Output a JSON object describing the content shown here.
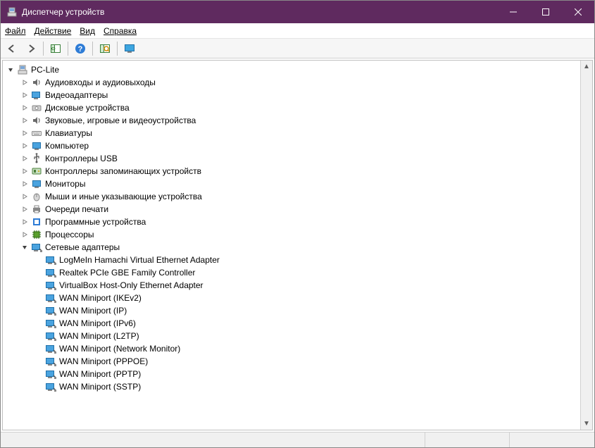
{
  "window": {
    "title": "Диспетчер устройств"
  },
  "menu": {
    "file": "Файл",
    "action": "Действие",
    "view": "Вид",
    "help": "Справка"
  },
  "toolbar": {
    "back": "Назад",
    "forward": "Вперёд",
    "show_hide": "Показать/скрыть дерево консоли",
    "help": "Справка",
    "scan": "Обновить конфигурацию оборудования",
    "monitor": "Мониторинг"
  },
  "tree": {
    "root": {
      "label": "PC-Lite",
      "icon": "computer-icon",
      "expanded": true
    },
    "categories": [
      {
        "label": "Аудиовходы и аудиовыходы",
        "icon": "audio-icon",
        "expanded": false,
        "children": []
      },
      {
        "label": "Видеоадаптеры",
        "icon": "display-adapter-icon",
        "expanded": false,
        "children": []
      },
      {
        "label": "Дисковые устройства",
        "icon": "disk-icon",
        "expanded": false,
        "children": []
      },
      {
        "label": "Звуковые, игровые и видеоустройства",
        "icon": "sound-icon",
        "expanded": false,
        "children": []
      },
      {
        "label": "Клавиатуры",
        "icon": "keyboard-icon",
        "expanded": false,
        "children": []
      },
      {
        "label": "Компьютер",
        "icon": "pc-icon",
        "expanded": false,
        "children": []
      },
      {
        "label": "Контроллеры USB",
        "icon": "usb-icon",
        "expanded": false,
        "children": []
      },
      {
        "label": "Контроллеры запоминающих устройств",
        "icon": "storage-ctrl-icon",
        "expanded": false,
        "children": []
      },
      {
        "label": "Мониторы",
        "icon": "monitor-icon",
        "expanded": false,
        "children": []
      },
      {
        "label": "Мыши и иные указывающие устройства",
        "icon": "mouse-icon",
        "expanded": false,
        "children": []
      },
      {
        "label": "Очереди печати",
        "icon": "printer-icon",
        "expanded": false,
        "children": []
      },
      {
        "label": "Программные устройства",
        "icon": "software-icon",
        "expanded": false,
        "children": []
      },
      {
        "label": "Процессоры",
        "icon": "cpu-icon",
        "expanded": false,
        "children": []
      },
      {
        "label": "Сетевые адаптеры",
        "icon": "network-icon",
        "expanded": true,
        "children": [
          {
            "label": "LogMeIn Hamachi Virtual Ethernet Adapter",
            "icon": "nic-icon"
          },
          {
            "label": "Realtek PCIe GBE Family Controller",
            "icon": "nic-icon"
          },
          {
            "label": "VirtualBox Host-Only Ethernet Adapter",
            "icon": "nic-icon"
          },
          {
            "label": "WAN Miniport (IKEv2)",
            "icon": "nic-icon"
          },
          {
            "label": "WAN Miniport (IP)",
            "icon": "nic-icon"
          },
          {
            "label": "WAN Miniport (IPv6)",
            "icon": "nic-icon"
          },
          {
            "label": "WAN Miniport (L2TP)",
            "icon": "nic-icon"
          },
          {
            "label": "WAN Miniport (Network Monitor)",
            "icon": "nic-icon"
          },
          {
            "label": "WAN Miniport (PPPOE)",
            "icon": "nic-icon"
          },
          {
            "label": "WAN Miniport (PPTP)",
            "icon": "nic-icon"
          },
          {
            "label": "WAN Miniport (SSTP)",
            "icon": "nic-icon"
          }
        ]
      }
    ]
  },
  "colors": {
    "titlebar": "#5f2a5f",
    "accent": "#0078d7"
  }
}
